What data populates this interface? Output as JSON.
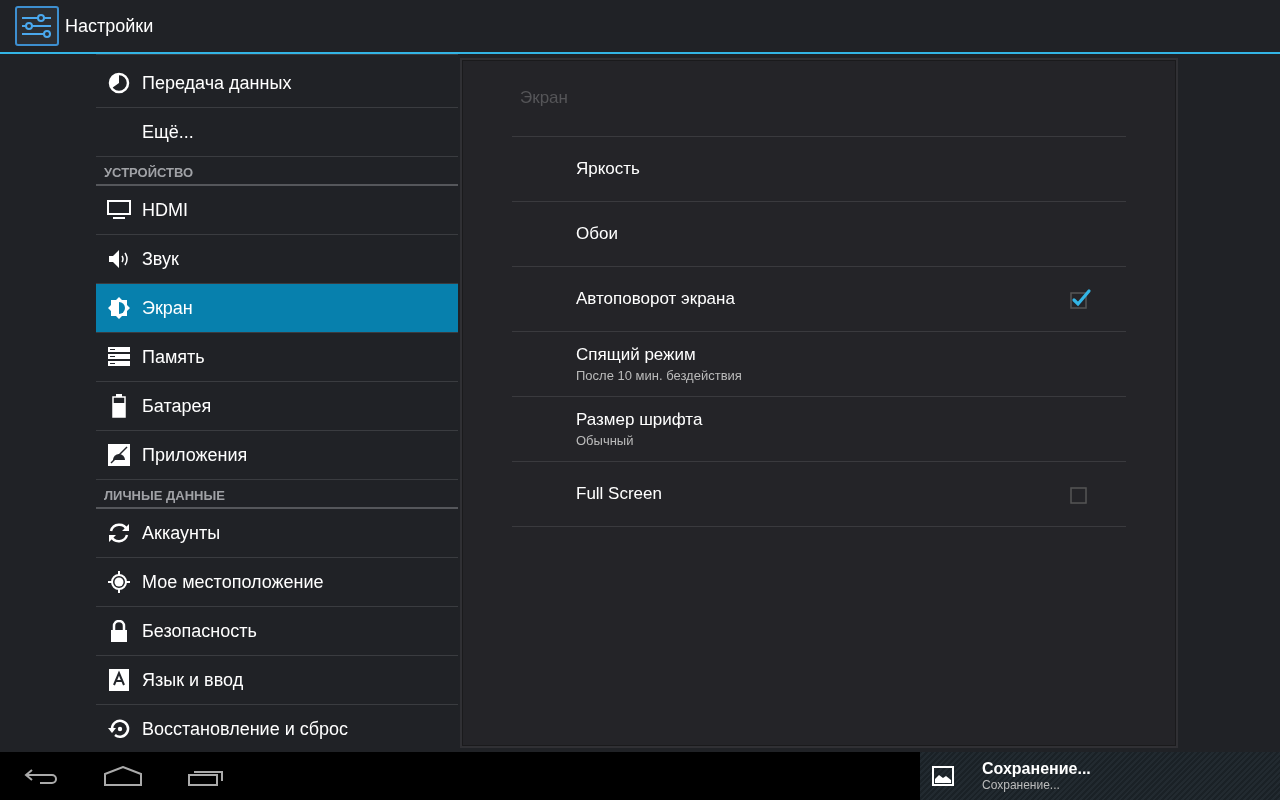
{
  "action_bar": {
    "title": "Настройки"
  },
  "sidebar": {
    "items": [
      {
        "kind": "item",
        "label": "Передача данных",
        "selected": false
      },
      {
        "kind": "item",
        "label": "Ещё...",
        "selected": false
      },
      {
        "kind": "header",
        "label": "УСТРОЙСТВО"
      },
      {
        "kind": "item",
        "label": "HDMI",
        "selected": false
      },
      {
        "kind": "item",
        "label": "Звук",
        "selected": false
      },
      {
        "kind": "item",
        "label": "Экран",
        "selected": true
      },
      {
        "kind": "item",
        "label": "Память",
        "selected": false
      },
      {
        "kind": "item",
        "label": "Батарея",
        "selected": false
      },
      {
        "kind": "item",
        "label": "Приложения",
        "selected": false
      },
      {
        "kind": "header",
        "label": "ЛИЧНЫЕ ДАННЫЕ"
      },
      {
        "kind": "item",
        "label": "Аккаунты",
        "selected": false
      },
      {
        "kind": "item",
        "label": "Мое местоположение",
        "selected": false
      },
      {
        "kind": "item",
        "label": "Безопасность",
        "selected": false
      },
      {
        "kind": "item",
        "label": "Язык и ввод",
        "selected": false
      },
      {
        "kind": "item",
        "label": "Восстановление и сброс",
        "selected": false
      }
    ]
  },
  "panel": {
    "title": "Экран",
    "rows": [
      {
        "kind": "plain",
        "label": "Яркость"
      },
      {
        "kind": "plain",
        "label": "Обои"
      },
      {
        "kind": "checkbox",
        "label": "Автоповорот экрана",
        "checked": true
      },
      {
        "kind": "plain",
        "label": "Спящий режим",
        "summary": "После 10 мин. бездействия"
      },
      {
        "kind": "plain",
        "label": "Размер шрифта",
        "summary": "Обычный"
      },
      {
        "kind": "checkbox",
        "label": "Full Screen",
        "checked": false
      }
    ]
  },
  "notification": {
    "title": "Сохранение...",
    "text": "Сохранение..."
  }
}
